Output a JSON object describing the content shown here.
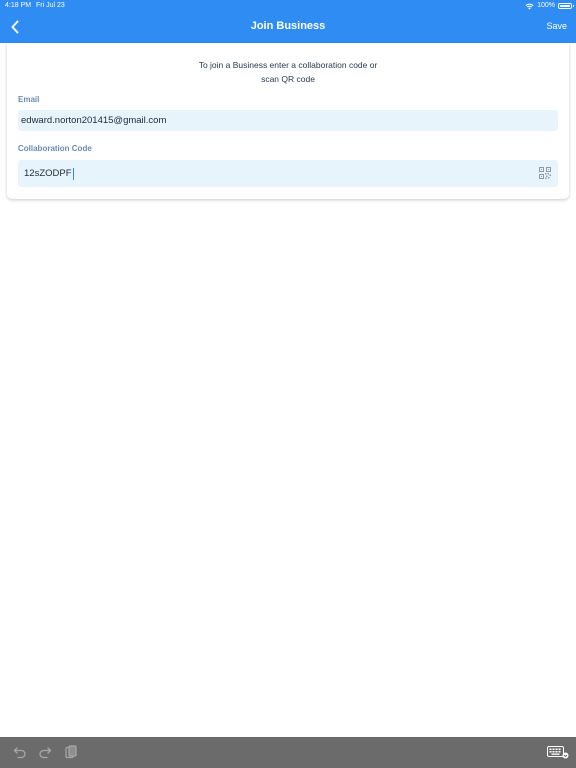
{
  "status_bar": {
    "time": "4:18 PM",
    "date": "Fri Jul 23",
    "battery": "100%"
  },
  "nav": {
    "title": "Join Business",
    "save_label": "Save"
  },
  "form": {
    "instructions_line1": "To join a Business enter a collaboration code or",
    "instructions_line2": "scan QR code",
    "email_label": "Email",
    "email_value": "edward.norton201415@gmail.com",
    "code_label": "Collaboration Code",
    "code_value": "12sZODPF"
  },
  "colors": {
    "accent": "#2f8cf3",
    "input_bg": "#e8f4fc",
    "toolbar_bg": "#6b6b6b"
  },
  "icons": {
    "back": "chevron-left-icon",
    "qr": "qr-code-icon",
    "undo": "undo-icon",
    "redo": "redo-icon",
    "paste": "paste-icon",
    "keyboard": "keyboard-icon"
  }
}
